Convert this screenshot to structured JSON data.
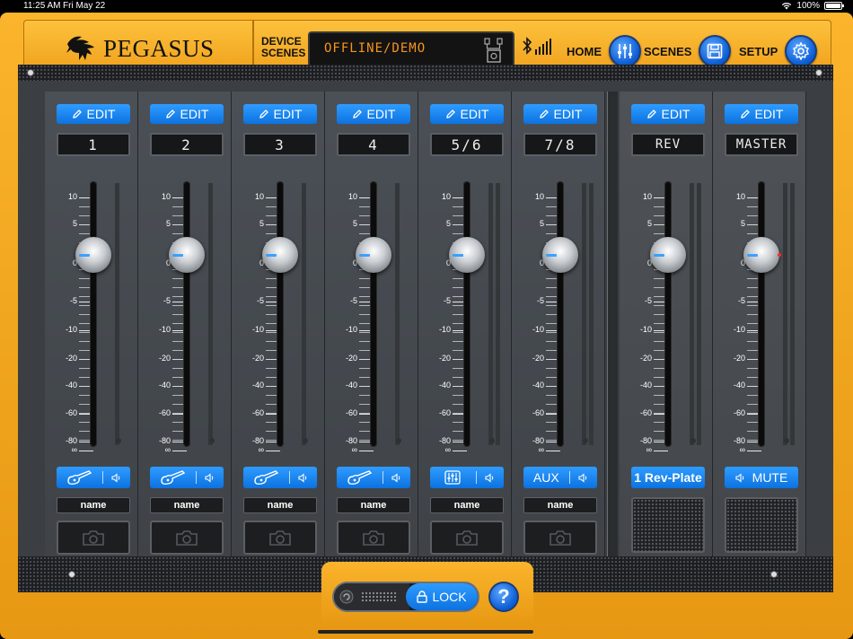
{
  "status": {
    "time": "11:25 AM",
    "date": "Fri May 22",
    "battery": "100%"
  },
  "header": {
    "brand": "PEGASUS",
    "device_label_1": "DEVICE",
    "device_label_2": "SCENES",
    "lcd_text": "OFFLINE/DEMO",
    "home_label": "HOME",
    "scenes_label": "SCENES",
    "setup_label": "SETUP"
  },
  "scale_labels": [
    "10",
    "5",
    "0",
    "-5",
    "-10",
    "-20",
    "-40",
    "-60",
    "-80",
    "∞"
  ],
  "channels": [
    {
      "edit": "EDIT",
      "lcd": "1",
      "input": "guitar-icon",
      "name": "name"
    },
    {
      "edit": "EDIT",
      "lcd": "2",
      "input": "guitar-icon",
      "name": "name"
    },
    {
      "edit": "EDIT",
      "lcd": "3",
      "input": "guitar-icon",
      "name": "name"
    },
    {
      "edit": "EDIT",
      "lcd": "4",
      "input": "guitar-icon",
      "name": "name"
    },
    {
      "edit": "EDIT",
      "lcd": "5/6",
      "input": "mixer-icon",
      "name": "name"
    },
    {
      "edit": "EDIT",
      "lcd": "7/8",
      "input": "AUX",
      "name": "name"
    }
  ],
  "outputs": [
    {
      "edit": "EDIT",
      "lcd": "REV",
      "button": "1 Rev-Plate"
    },
    {
      "edit": "EDIT",
      "lcd": "MASTER",
      "button": "MUTE"
    }
  ],
  "lock": {
    "label": "LOCK"
  },
  "help": {
    "label": "?"
  },
  "colors": {
    "accent": "#0c72e0",
    "frame": "#f3a81f",
    "lcd_text": "#f7941d",
    "panel": "#3b3f44"
  }
}
